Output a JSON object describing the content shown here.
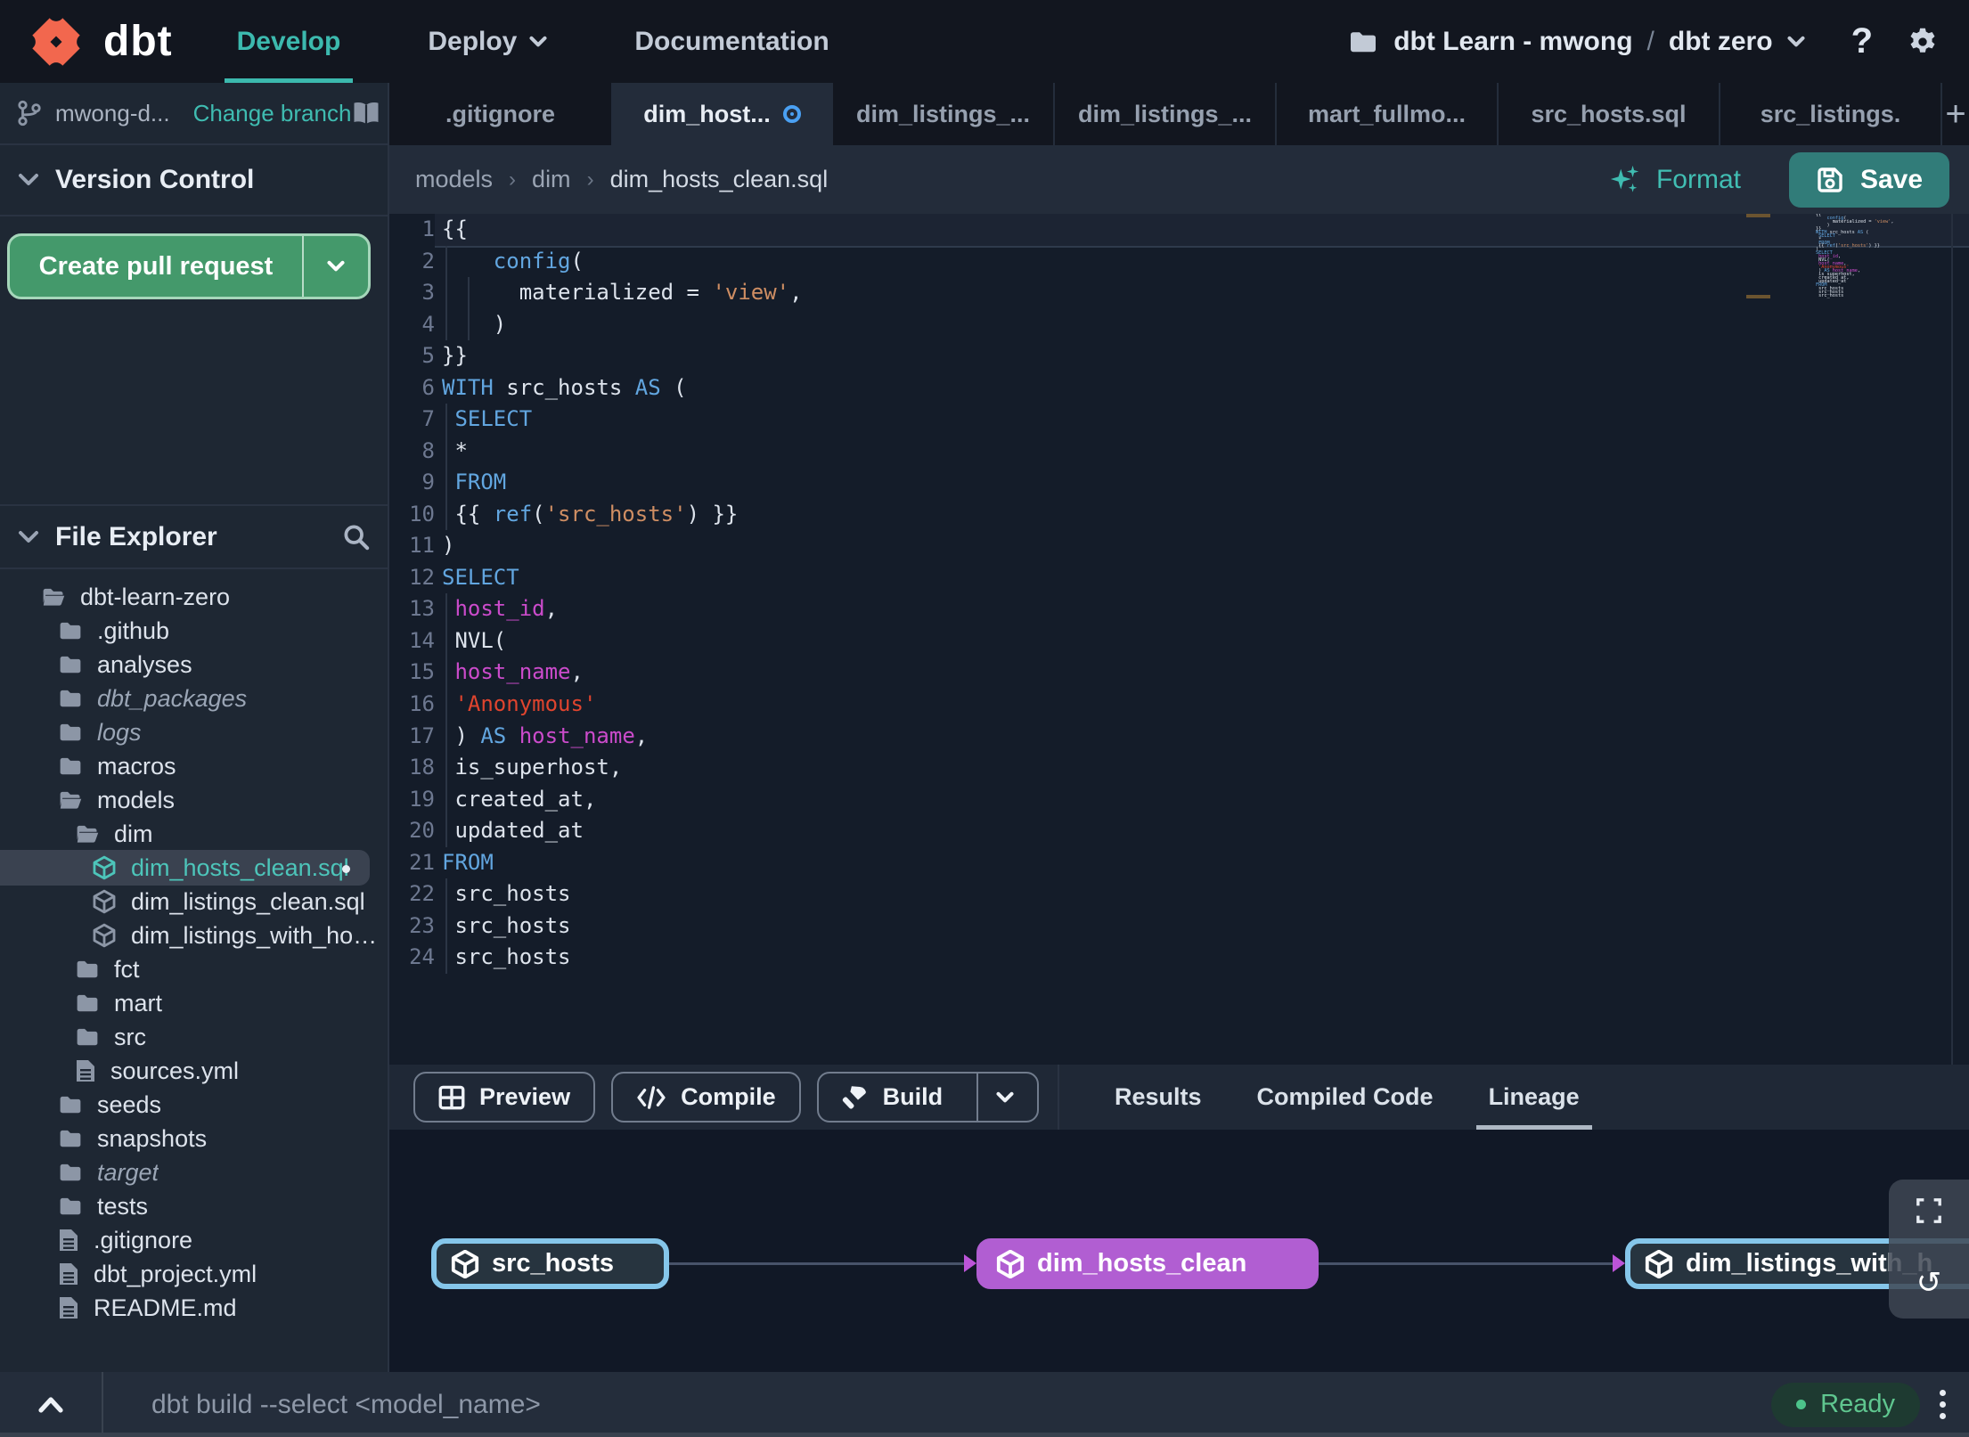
{
  "colors": {
    "accent_teal": "#3CB9AE",
    "logo_orange": "#F2674E",
    "save_teal": "#317C79",
    "pr_green": "#44996B",
    "node_purple": "#B15ED2",
    "node_blue_border": "#85C6EA",
    "ready_green": "#5FC68F",
    "modified_blue": "#4AA0F2",
    "keyword_blue": "#62A6E0",
    "ident_magenta": "#CB4BCB",
    "string_orange": "#CF8E63",
    "string_red": "#E0442E"
  },
  "header": {
    "logo_text": "dbt",
    "nav": [
      {
        "label": "Develop",
        "active": true
      },
      {
        "label": "Deploy",
        "chevron": true
      },
      {
        "label": "Documentation"
      }
    ],
    "project_label": "dbt Learn - mwong",
    "path_separator": "/",
    "project_name": "dbt zero",
    "help_label": "?"
  },
  "sidebar": {
    "branch_name": "mwong-d...",
    "change_branch_label": "Change branch",
    "version_control_title": "Version Control",
    "create_pr_label": "Create pull request",
    "file_explorer_title": "File Explorer",
    "tree": [
      {
        "name": "dbt-learn-zero",
        "icon": "folder-open",
        "level": 0
      },
      {
        "name": ".github",
        "icon": "folder",
        "level": 1
      },
      {
        "name": "analyses",
        "icon": "folder",
        "level": 1
      },
      {
        "name": "dbt_packages",
        "icon": "folder",
        "level": 1,
        "italic": true
      },
      {
        "name": "logs",
        "icon": "folder",
        "level": 1,
        "italic": true
      },
      {
        "name": "macros",
        "icon": "folder",
        "level": 1
      },
      {
        "name": "models",
        "icon": "folder-open",
        "level": 1
      },
      {
        "name": "dim",
        "icon": "folder-open",
        "level": 2
      },
      {
        "name": "dim_hosts_clean.sql",
        "icon": "model",
        "level": 3,
        "selected": true,
        "modified": true
      },
      {
        "name": "dim_listings_clean.sql",
        "icon": "model",
        "level": 3
      },
      {
        "name": "dim_listings_with_hosts...",
        "icon": "model",
        "level": 3
      },
      {
        "name": "fct",
        "icon": "folder",
        "level": 2
      },
      {
        "name": "mart",
        "icon": "folder",
        "level": 2
      },
      {
        "name": "src",
        "icon": "folder",
        "level": 2
      },
      {
        "name": "sources.yml",
        "icon": "file",
        "level": 2
      },
      {
        "name": "seeds",
        "icon": "folder",
        "level": 1
      },
      {
        "name": "snapshots",
        "icon": "folder",
        "level": 1
      },
      {
        "name": "target",
        "icon": "folder",
        "level": 1,
        "italic": true
      },
      {
        "name": "tests",
        "icon": "folder",
        "level": 1
      },
      {
        "name": ".gitignore",
        "icon": "file",
        "level": 1
      },
      {
        "name": "dbt_project.yml",
        "icon": "file",
        "level": 1
      },
      {
        "name": "README.md",
        "icon": "file",
        "level": 1
      }
    ]
  },
  "tabs": {
    "items": [
      {
        "label": ".gitignore"
      },
      {
        "label": "dim_host...",
        "active": true,
        "modified": true
      },
      {
        "label": "dim_listings_..."
      },
      {
        "label": "dim_listings_..."
      },
      {
        "label": "mart_fullmo..."
      },
      {
        "label": "src_hosts.sql"
      },
      {
        "label": "src_listings."
      }
    ],
    "add_label": "+"
  },
  "breadcrumb": [
    "models",
    "dim",
    "dim_hosts_clean.sql"
  ],
  "actions": {
    "format_label": "Format",
    "save_label": "Save"
  },
  "editor": {
    "lines": [
      {
        "n": 1,
        "cur": true,
        "t": [
          [
            "{{",
            "p"
          ]
        ]
      },
      {
        "n": 2,
        "t": [
          [
            "    ",
            "p"
          ],
          [
            "config",
            "kw"
          ],
          [
            "(",
            "p"
          ]
        ]
      },
      {
        "n": 3,
        "t": [
          [
            "      materialized = ",
            "p"
          ],
          [
            "'view'",
            "str"
          ],
          [
            ",",
            "p"
          ]
        ]
      },
      {
        "n": 4,
        "t": [
          [
            "    )",
            "p"
          ]
        ]
      },
      {
        "n": 5,
        "t": [
          [
            "}}",
            "p"
          ]
        ]
      },
      {
        "n": 6,
        "t": [
          [
            "WITH",
            "kw"
          ],
          [
            " src_hosts ",
            "p"
          ],
          [
            "AS",
            "kw"
          ],
          [
            " (",
            "p"
          ]
        ]
      },
      {
        "n": 7,
        "t": [
          [
            " ",
            "p"
          ],
          [
            "SELECT",
            "kw"
          ]
        ]
      },
      {
        "n": 8,
        "t": [
          [
            " *",
            "p"
          ]
        ]
      },
      {
        "n": 9,
        "t": [
          [
            " ",
            "p"
          ],
          [
            "FROM",
            "kw"
          ]
        ]
      },
      {
        "n": 10,
        "t": [
          [
            " {{ ",
            "p"
          ],
          [
            "ref",
            "kw"
          ],
          [
            "(",
            "p"
          ],
          [
            "'src_hosts'",
            "str"
          ],
          [
            ") }}",
            "p"
          ]
        ]
      },
      {
        "n": 11,
        "t": [
          [
            ")",
            "p"
          ]
        ]
      },
      {
        "n": 12,
        "t": [
          [
            "SELECT",
            "kw"
          ]
        ]
      },
      {
        "n": 13,
        "t": [
          [
            " ",
            "p"
          ],
          [
            "host_id",
            "id"
          ],
          [
            ",",
            "p"
          ]
        ]
      },
      {
        "n": 14,
        "t": [
          [
            " NVL(",
            "p"
          ]
        ]
      },
      {
        "n": 15,
        "t": [
          [
            " ",
            "p"
          ],
          [
            "host_name",
            "id"
          ],
          [
            ",",
            "p"
          ]
        ]
      },
      {
        "n": 16,
        "t": [
          [
            " ",
            "p"
          ],
          [
            "'Anonymous'",
            "str2"
          ]
        ]
      },
      {
        "n": 17,
        "t": [
          [
            " ) ",
            "p"
          ],
          [
            "AS",
            "kw"
          ],
          [
            " ",
            "p"
          ],
          [
            "host_name",
            "id"
          ],
          [
            ",",
            "p"
          ]
        ]
      },
      {
        "n": 18,
        "t": [
          [
            " is_superhost,",
            "p"
          ]
        ]
      },
      {
        "n": 19,
        "t": [
          [
            " created_at,",
            "p"
          ]
        ]
      },
      {
        "n": 20,
        "t": [
          [
            " updated_at",
            "p"
          ]
        ]
      },
      {
        "n": 21,
        "t": [
          [
            "FROM",
            "kw"
          ]
        ]
      },
      {
        "n": 22,
        "t": [
          [
            " src_hosts",
            "p"
          ]
        ]
      },
      {
        "n": 23,
        "t": [
          [
            " src_hosts",
            "p"
          ]
        ]
      },
      {
        "n": 24,
        "t": [
          [
            " src_hosts",
            "p"
          ]
        ]
      }
    ]
  },
  "panel": {
    "buttons": [
      {
        "label": "Preview",
        "icon": "grid"
      },
      {
        "label": "Compile",
        "icon": "code"
      },
      {
        "label": "Build",
        "icon": "hammer",
        "split": true
      }
    ],
    "tabs": [
      {
        "label": "Results"
      },
      {
        "label": "Compiled Code"
      },
      {
        "label": "Lineage",
        "active": true
      }
    ]
  },
  "lineage": {
    "nodes": [
      {
        "label": "src_hosts",
        "style": "outlined"
      },
      {
        "label": "dim_hosts_clean",
        "style": "purple"
      },
      {
        "label": "dim_listings_with_h",
        "style": "outlined"
      }
    ]
  },
  "statusbar": {
    "command": "dbt build --select <model_name>",
    "ready_label": "Ready"
  }
}
